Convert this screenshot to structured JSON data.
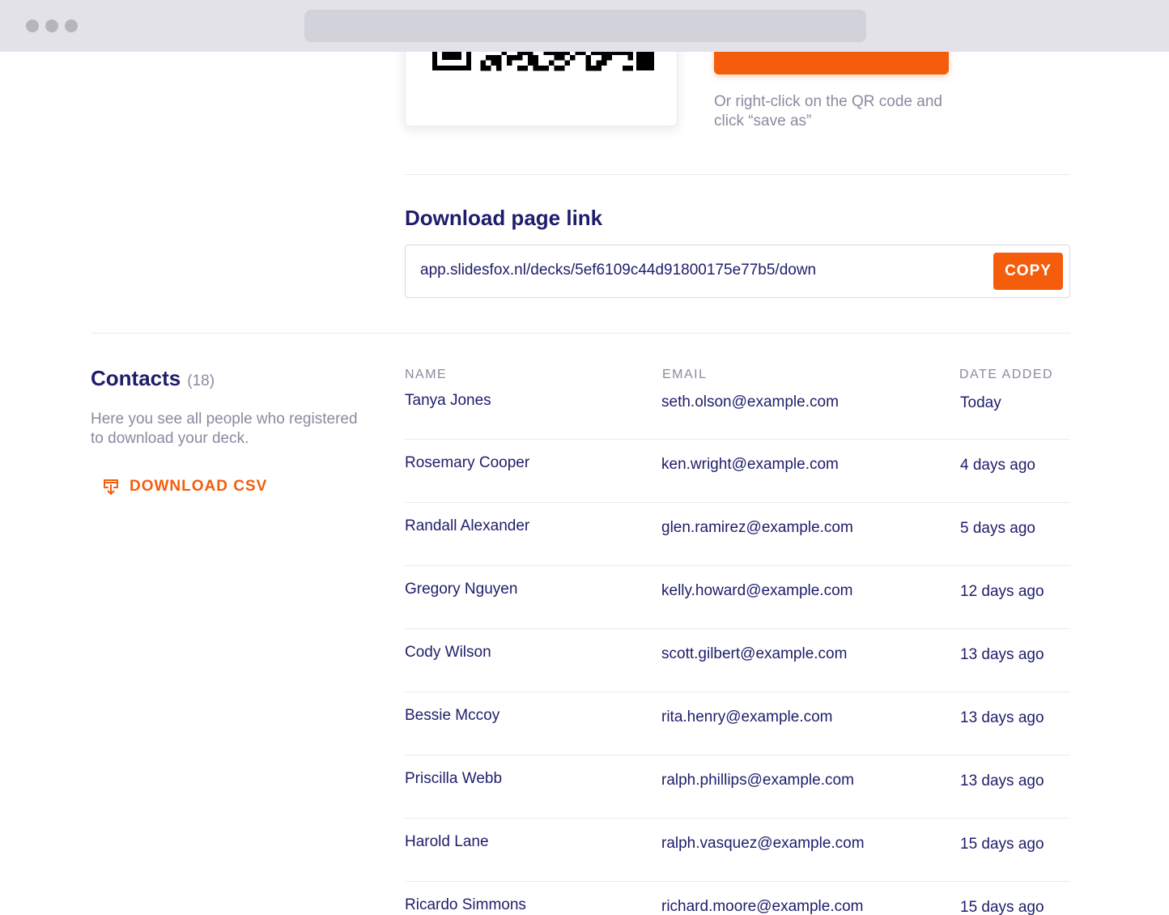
{
  "qr": {
    "hint": "Or right-click on the QR code and click “save as”"
  },
  "link_section": {
    "title": "Download page link",
    "url": "app.slidesfox.nl/decks/5ef6109c44d91800175e77b5/down",
    "copy_label": "COPY"
  },
  "contacts": {
    "title": "Contacts",
    "count": "(18)",
    "description": "Here you see all people who registered to download your deck.",
    "download_csv_label": "DOWNLOAD CSV",
    "columns": {
      "name": "NAME",
      "email": "EMAIL",
      "date": "DATE ADDED"
    },
    "rows": [
      {
        "name": "Tanya Jones",
        "email": "seth.olson@example.com",
        "date": "Today"
      },
      {
        "name": "Rosemary Cooper",
        "email": "ken.wright@example.com",
        "date": "4 days ago"
      },
      {
        "name": "Randall Alexander",
        "email": "glen.ramirez@example.com",
        "date": "5 days ago"
      },
      {
        "name": "Gregory Nguyen",
        "email": "kelly.howard@example.com",
        "date": "12 days ago"
      },
      {
        "name": "Cody Wilson",
        "email": "scott.gilbert@example.com",
        "date": "13 days ago"
      },
      {
        "name": "Bessie Mccoy",
        "email": "rita.henry@example.com",
        "date": "13 days ago"
      },
      {
        "name": "Priscilla Webb",
        "email": "ralph.phillips@example.com",
        "date": "13 days ago"
      },
      {
        "name": "Harold Lane",
        "email": "ralph.vasquez@example.com",
        "date": "15 days ago"
      },
      {
        "name": "Ricardo Simmons",
        "email": "richard.moore@example.com",
        "date": "15 days ago"
      }
    ]
  },
  "colors": {
    "accent": "#f45d0c",
    "text_primary": "#1f1d6b",
    "text_muted": "#8b8a9f",
    "divider": "#ebebf0"
  }
}
